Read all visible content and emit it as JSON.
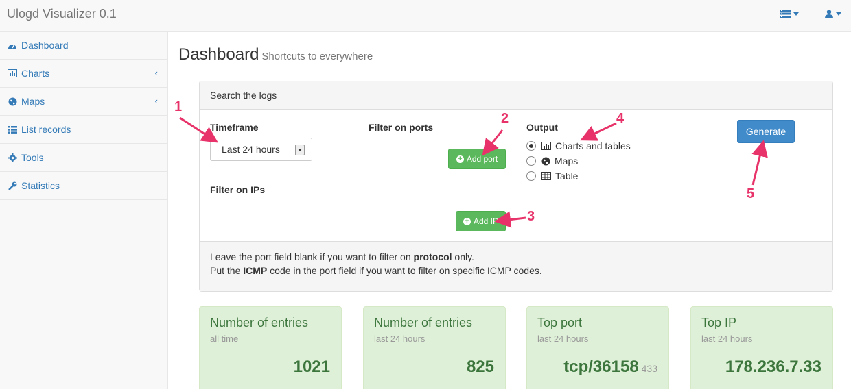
{
  "app": {
    "title": "Ulogd Visualizer 0.1"
  },
  "sidebar": {
    "items": [
      {
        "label": "Dashboard",
        "icon": "dashboard-icon"
      },
      {
        "label": "Charts",
        "icon": "bar-chart-icon",
        "expandable": true
      },
      {
        "label": "Maps",
        "icon": "globe-icon",
        "expandable": true
      },
      {
        "label": "List records",
        "icon": "list-icon"
      },
      {
        "label": "Tools",
        "icon": "gear-icon"
      },
      {
        "label": "Statistics",
        "icon": "wrench-icon"
      }
    ]
  },
  "page": {
    "title": "Dashboard",
    "subtitle": "Shortcuts to everywhere"
  },
  "search": {
    "heading": "Search the logs",
    "timeframe_label": "Timeframe",
    "timeframe_value": "Last 24 hours",
    "ports_label": "Filter on ports",
    "add_port": "Add port",
    "ips_label": "Filter on IPs",
    "add_ip": "Add IP",
    "output_label": "Output",
    "output_options": [
      "Charts and tables",
      "Maps",
      "Table"
    ],
    "output_selected": "Charts and tables",
    "generate": "Generate",
    "help1_pre": "Leave the port field blank if you want to filter on ",
    "help1_bold": "protocol",
    "help1_post": " only.",
    "help2_pre": "Put the ",
    "help2_bold": "ICMP",
    "help2_post": " code in the port field if you want to filter on specific ICMP codes."
  },
  "annotations": [
    "1",
    "2",
    "3",
    "4",
    "5"
  ],
  "stats": [
    {
      "title": "Number of entries",
      "sub": "all time",
      "value": "1021",
      "extra": ""
    },
    {
      "title": "Number of entries",
      "sub": "last 24 hours",
      "value": "825",
      "extra": ""
    },
    {
      "title": "Top port",
      "sub": "last 24 hours",
      "value": "tcp/36158",
      "extra": "433"
    },
    {
      "title": "Top IP",
      "sub": "last 24 hours",
      "value": "178.236.7.33",
      "extra": ""
    }
  ],
  "colors": {
    "link": "#337ab7",
    "success": "#5cb85c",
    "primary": "#428bca",
    "annotation": "#e8336a",
    "card_bg": "#dff0d8"
  }
}
